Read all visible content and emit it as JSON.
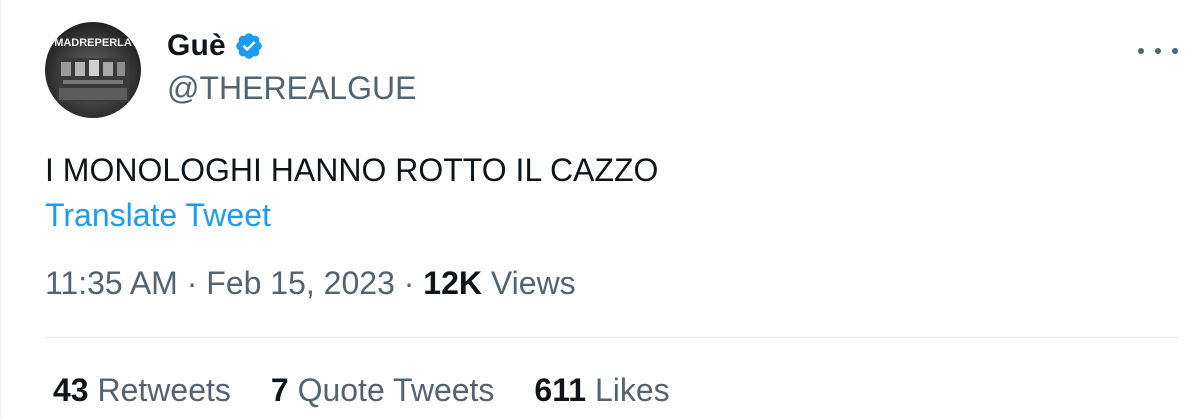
{
  "tweet": {
    "author": {
      "display_name": "Guè",
      "handle": "@THEREALGUE",
      "verified": true,
      "avatar_text": "MADREPERLA"
    },
    "text": "I MONOLOGHI HANNO ROTTO IL CAZZO",
    "translate_label": "Translate Tweet",
    "time": "11:35 AM",
    "date": "Feb 15, 2023",
    "views_count": "12K",
    "views_label": "Views",
    "separator": "·",
    "stats": {
      "retweets_count": "43",
      "retweets_label": "Retweets",
      "quotes_count": "7",
      "quotes_label": "Quote Tweets",
      "likes_count": "611",
      "likes_label": "Likes"
    }
  },
  "icons": {
    "verified": "verified-badge-icon",
    "more": "more-options-icon"
  },
  "colors": {
    "link": "#1d9bf0",
    "secondary_text": "#536471",
    "primary_text": "#0f1419",
    "divider": "#e7e9ea"
  }
}
